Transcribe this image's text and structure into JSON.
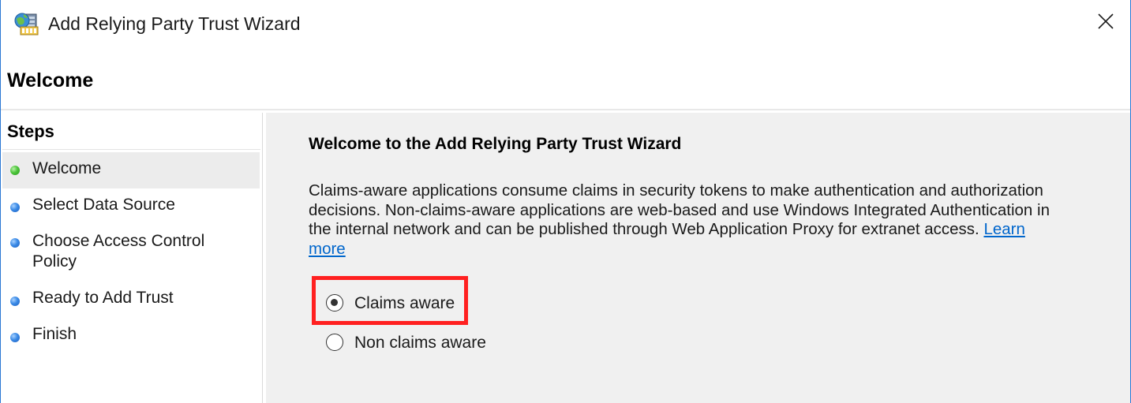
{
  "window": {
    "title": "Add Relying Party Trust Wizard",
    "accent_color": "#2b78d4"
  },
  "icons": {
    "app": "server-globe-icon",
    "close": "close-icon",
    "step_current": "green-dot-icon",
    "step_pending": "blue-dot-icon"
  },
  "page": {
    "title": "Welcome"
  },
  "steps": {
    "title": "Steps",
    "items": [
      {
        "label": "Welcome",
        "state": "current"
      },
      {
        "label": "Select Data Source",
        "state": "pending"
      },
      {
        "label": "Choose Access Control Policy",
        "state": "pending"
      },
      {
        "label": "Ready to Add Trust",
        "state": "pending"
      },
      {
        "label": "Finish",
        "state": "pending"
      }
    ]
  },
  "content": {
    "heading": "Welcome to the Add Relying Party Trust Wizard",
    "description": "Claims-aware applications consume claims in security tokens to make authentication and authorization decisions. Non-claims-aware applications are web-based and use Windows Integrated Authentication in the internal network and can be published through Web Application Proxy for extranet access.",
    "learn_more": "Learn more",
    "options": [
      {
        "label": "Claims aware",
        "selected": true
      },
      {
        "label": "Non claims aware",
        "selected": false
      }
    ],
    "highlight_color": "#ff2020"
  }
}
